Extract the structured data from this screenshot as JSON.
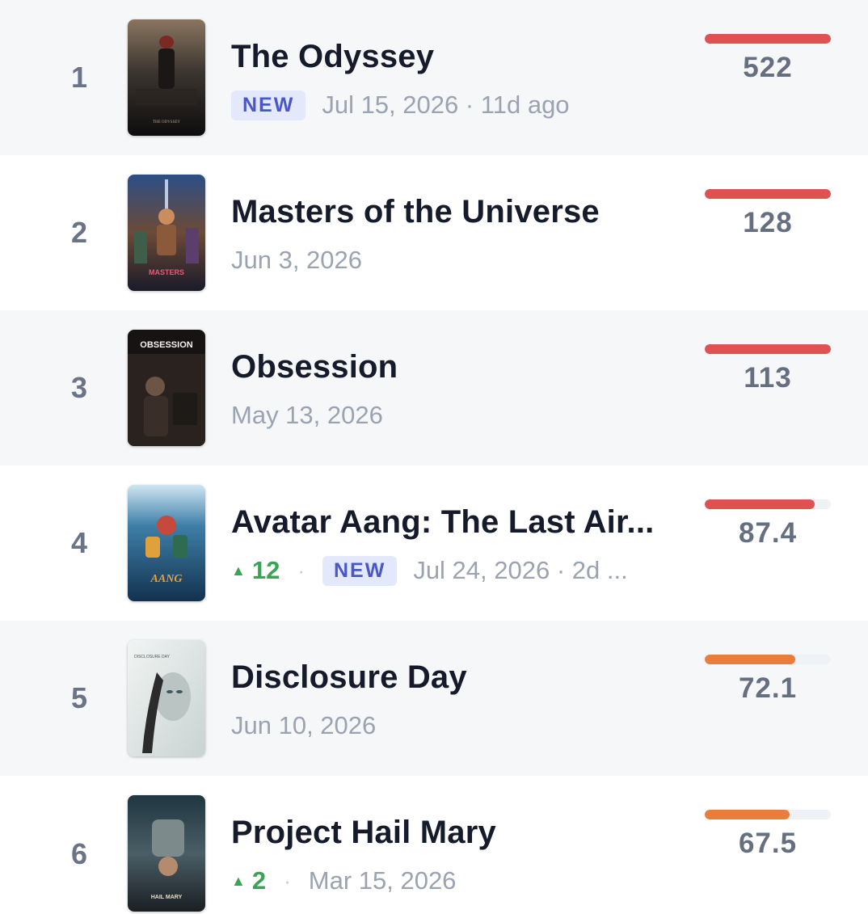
{
  "rankings": [
    {
      "rank": "1",
      "title": "The Odyssey",
      "new_badge": "NEW",
      "date": "Jul 15, 2026 · 11d ago",
      "score": "522",
      "score_fraction": 1.0,
      "bar_color": "#e05252",
      "poster_text": "THE ODYSSEY"
    },
    {
      "rank": "2",
      "title": "Masters of the Universe",
      "date": "Jun 3, 2026",
      "score": "128",
      "score_fraction": 1.0,
      "bar_color": "#e05252",
      "poster_text": "MASTERS"
    },
    {
      "rank": "3",
      "title": "Obsession",
      "date": "May 13, 2026",
      "score": "113",
      "score_fraction": 1.0,
      "bar_color": "#e05252",
      "poster_text": "OBSESSION"
    },
    {
      "rank": "4",
      "title": "Avatar Aang: The Last Air...",
      "delta": "12",
      "new_badge": "NEW",
      "date": "Jul 24, 2026 · 2d ...",
      "score": "87.4",
      "score_fraction": 0.874,
      "bar_color": "#e05252",
      "poster_text": "AANG"
    },
    {
      "rank": "5",
      "title": "Disclosure Day",
      "date": "Jun 10, 2026",
      "score": "72.1",
      "score_fraction": 0.721,
      "bar_color": "#ea7d3c",
      "poster_text": "DISCLOSURE DAY"
    },
    {
      "rank": "6",
      "title": "Project Hail Mary",
      "delta": "2",
      "date": "Mar 15, 2026",
      "score": "67.5",
      "score_fraction": 0.675,
      "bar_color": "#ea7d3c",
      "poster_text": "HAIL MARY"
    }
  ],
  "icons": {
    "delta_up": "triangle-up-icon",
    "separator": "dot-separator"
  }
}
